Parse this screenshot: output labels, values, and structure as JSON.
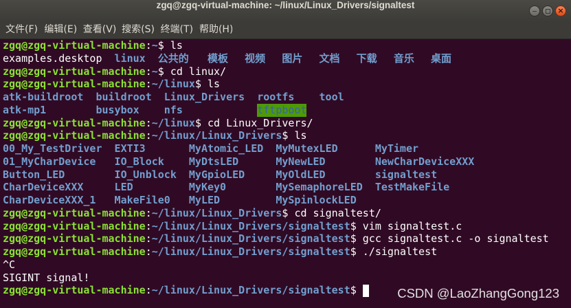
{
  "window": {
    "title": "zgq@zgq-virtual-machine: ~/linux/Linux_Drivers/signaltest",
    "controls": {
      "minimize": "minimize-icon",
      "maximize": "maximize-icon",
      "close": "close-icon"
    }
  },
  "menu": {
    "file": "文件(F)",
    "edit": "编辑(E)",
    "view": "查看(V)",
    "search": "搜索(S)",
    "terminal": "终端(T)",
    "help": "帮助(H)"
  },
  "colors": {
    "terminal_background": "#300a24",
    "text": "#ffffff",
    "prompt_user_host": "#8ae234",
    "prompt_path": "#729fcf",
    "directory": "#729fcf",
    "other_writable_dir_background": "#4e9a06",
    "other_writable_dir_text": "#3465a4",
    "close_button": "#e95420"
  },
  "terminal": {
    "lines": [
      {
        "user": "zgq@zgq-virtual-machine",
        "sep": ":",
        "path": "~",
        "symbol": "$",
        "command": "ls"
      },
      {
        "items": [
          "examples.desktop",
          "linux",
          "公共的",
          "模板",
          "视频",
          "图片",
          "文档",
          "下载",
          "音乐",
          "桌面"
        ]
      },
      {
        "user": "zgq@zgq-virtual-machine",
        "sep": ":",
        "path": "~",
        "symbol": "$",
        "command": "cd linux/"
      },
      {
        "user": "zgq@zgq-virtual-machine",
        "sep": ":",
        "path": "~/linux",
        "symbol": "$",
        "command": "ls"
      },
      {
        "items": [
          "atk-buildroot",
          "buildroot",
          "Linux_Drivers",
          "rootfs",
          "tool"
        ]
      },
      {
        "items": [
          "atk-mp1",
          "busybox",
          "nfs",
          "tftpboot"
        ]
      },
      {
        "user": "zgq@zgq-virtual-machine",
        "sep": ":",
        "path": "~/linux",
        "symbol": "$",
        "command": "cd Linux_Drivers/"
      },
      {
        "user": "zgq@zgq-virtual-machine",
        "sep": ":",
        "path": "~/linux/Linux_Drivers",
        "symbol": "$",
        "command": "ls"
      },
      {
        "items": [
          "00_My_TestDriver",
          "EXTI3",
          "MyAtomic_LED",
          "MyMutexLED",
          "MyTimer"
        ]
      },
      {
        "items": [
          "01_MyCharDevice",
          "IO_Block",
          "MyDtsLED",
          "MyNewLED",
          "NewCharDeviceXXX"
        ]
      },
      {
        "items": [
          "Button_LED",
          "IO_Unblock",
          "MyGpioLED",
          "MyOldLED",
          "signaltest"
        ]
      },
      {
        "items": [
          "CharDeviceXXX",
          "LED",
          "MyKey0",
          "MySemaphoreLED",
          "TestMakeFile"
        ]
      },
      {
        "items": [
          "CharDeviceXXX_1",
          "MakeFile0",
          "MyLED",
          "MySpinlockLED"
        ]
      },
      {
        "user": "zgq@zgq-virtual-machine",
        "sep": ":",
        "path": "~/linux/Linux_Drivers",
        "symbol": "$",
        "command": "cd signaltest/"
      },
      {
        "user": "zgq@zgq-virtual-machine",
        "sep": ":",
        "path": "~/linux/Linux_Drivers/signaltest",
        "symbol": "$",
        "command": "vim signaltest.c"
      },
      {
        "user": "zgq@zgq-virtual-machine",
        "sep": ":",
        "path": "~/linux/Linux_Drivers/signaltest",
        "symbol": "$",
        "command": "gcc signaltest.c -o signaltest"
      },
      {
        "user": "zgq@zgq-virtual-machine",
        "sep": ":",
        "path": "~/linux/Linux_Drivers/signaltest",
        "symbol": "$",
        "command": "./signaltest"
      },
      {
        "text": "^C"
      },
      {
        "text": "SIGINT signal!"
      },
      {
        "user": "zgq@zgq-virtual-machine",
        "sep": ":",
        "path": "~/linux/Linux_Drivers/signaltest",
        "symbol": "$"
      }
    ]
  },
  "watermark": "CSDN @LaoZhangGong123"
}
